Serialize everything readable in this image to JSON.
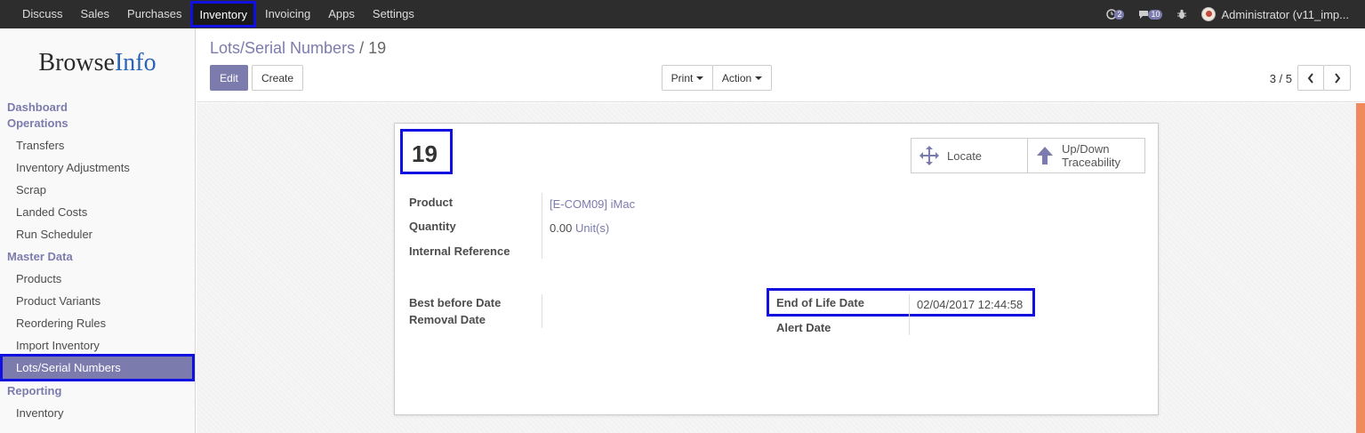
{
  "topnav": {
    "items": [
      "Discuss",
      "Sales",
      "Purchases",
      "Inventory",
      "Invoicing",
      "Apps",
      "Settings"
    ],
    "active": "Inventory",
    "chat_badge": "2",
    "messages_badge": "10",
    "user": "Administrator (v11_imp..."
  },
  "sidebar": {
    "logo_browse": "Browse",
    "logo_info": "Info",
    "sections": [
      {
        "title": "Dashboard",
        "items": []
      },
      {
        "title": "Operations",
        "items": [
          "Transfers",
          "Inventory Adjustments",
          "Scrap",
          "Landed Costs",
          "Run Scheduler"
        ]
      },
      {
        "title": "Master Data",
        "items": [
          "Products",
          "Product Variants",
          "Reordering Rules",
          "Import Inventory",
          "Lots/Serial Numbers"
        ]
      },
      {
        "title": "Reporting",
        "items": [
          "Inventory"
        ]
      }
    ],
    "active_item": "Lots/Serial Numbers"
  },
  "control_panel": {
    "breadcrumb_parent": "Lots/Serial Numbers",
    "breadcrumb_sep": "/",
    "breadcrumb_current": "19",
    "edit_label": "Edit",
    "create_label": "Create",
    "print_label": "Print",
    "action_label": "Action",
    "pager": "3 / 5"
  },
  "record": {
    "name": "19",
    "locate_label": "Locate",
    "traceability_label_1": "Up/Down",
    "traceability_label_2": "Traceability",
    "product_label": "Product",
    "product_value": "[E-COM09] iMac",
    "quantity_label": "Quantity",
    "quantity_value": "0.00",
    "quantity_uom": "Unit(s)",
    "internal_ref_label": "Internal Reference",
    "best_before_label": "Best before Date",
    "removal_label": "Removal Date",
    "end_of_life_label": "End of Life Date",
    "end_of_life_value": "02/04/2017 12:44:58",
    "alert_label": "Alert Date"
  },
  "colors": {
    "accent": "#7c7bad",
    "highlight": "#1010e0",
    "navbar": "#2d2d2d"
  }
}
